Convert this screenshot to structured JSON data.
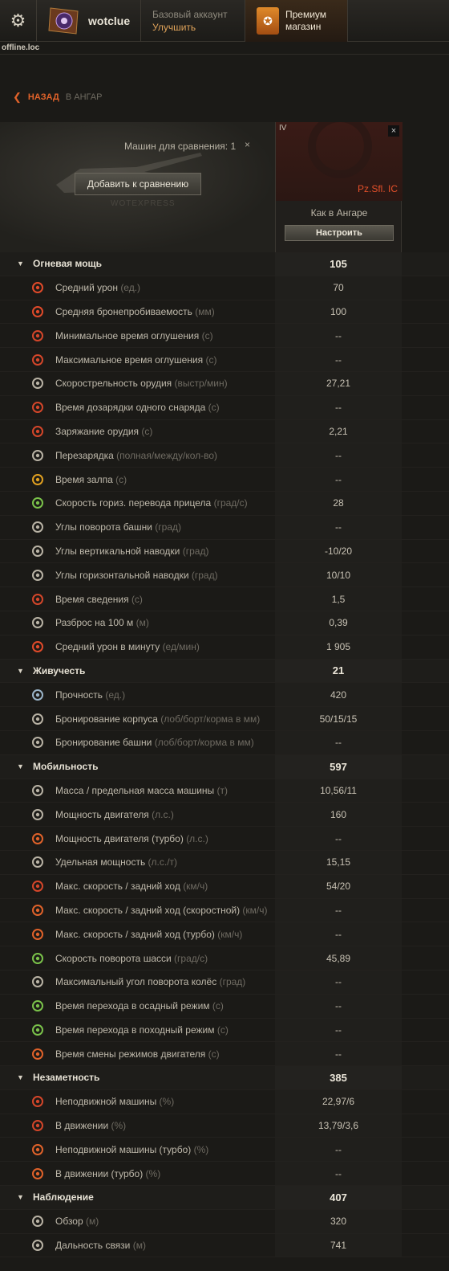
{
  "header": {
    "username": "wotclue",
    "account_type": "Базовый аккаунт",
    "upgrade": "Улучшить",
    "premium_line1": "Премиум",
    "premium_line2": "магазин",
    "server": "offline.loc"
  },
  "nav": {
    "back": "НАЗАД",
    "to_hangar": "В АНГАР"
  },
  "compare": {
    "count_label": "Машин для сравнения: 1",
    "close": "×",
    "add_button": "Добавить к сравнению",
    "watermark": "WOTEXPRESS"
  },
  "vehicle": {
    "tier": "IV",
    "name": "Pz.Sfl. IC",
    "config": "Как в Ангаре",
    "configure_button": "Настроить",
    "close": "×"
  },
  "sections": [
    {
      "title": "Огневая мощь",
      "value": "105",
      "items": [
        {
          "icon": "avg-damage-icon",
          "label": "Средний урон",
          "unit": "(ед.)",
          "value": "70",
          "color": "#e04a2a"
        },
        {
          "icon": "penetration-icon",
          "label": "Средняя бронепробиваемость",
          "unit": "(мм)",
          "value": "100",
          "color": "#e04a2a"
        },
        {
          "icon": "stun-min-icon",
          "label": "Минимальное время оглушения",
          "unit": "(с)",
          "value": "--",
          "color": "#d4462a"
        },
        {
          "icon": "stun-max-icon",
          "label": "Максимальное время оглушения",
          "unit": "(с)",
          "value": "--",
          "color": "#d4462a"
        },
        {
          "icon": "rate-of-fire-icon",
          "label": "Скорострельность орудия",
          "unit": "(выстр/мин)",
          "value": "27,21",
          "color": "#b9b3a5"
        },
        {
          "icon": "shell-reload-icon",
          "label": "Время дозарядки одного снаряда",
          "unit": "(с)",
          "value": "--",
          "color": "#d4462a"
        },
        {
          "icon": "reload-icon",
          "label": "Заряжание орудия",
          "unit": "(с)",
          "value": "2,21",
          "color": "#d4462a"
        },
        {
          "icon": "clip-reload-icon",
          "label": "Перезарядка",
          "unit": "(полная/между/кол-во)",
          "value": "--",
          "color": "#b9b3a5"
        },
        {
          "icon": "salvo-icon",
          "label": "Время залпа",
          "unit": "(с)",
          "value": "--",
          "color": "#e0a020"
        },
        {
          "icon": "traverse-icon",
          "label": "Скорость гориз. перевода прицела",
          "unit": "(град/с)",
          "value": "28",
          "color": "#7ac24a"
        },
        {
          "icon": "turret-angles-icon",
          "label": "Углы поворота башни",
          "unit": "(град)",
          "value": "--",
          "color": "#b9b3a5"
        },
        {
          "icon": "elevation-icon",
          "label": "Углы вертикальной наводки",
          "unit": "(град)",
          "value": "-10/20",
          "color": "#b9b3a5"
        },
        {
          "icon": "horizontal-angles-icon",
          "label": "Углы горизонтальной наводки",
          "unit": "(град)",
          "value": "10/10",
          "color": "#b9b3a5"
        },
        {
          "icon": "aim-time-icon",
          "label": "Время сведения",
          "unit": "(с)",
          "value": "1,5",
          "color": "#d4462a"
        },
        {
          "icon": "dispersion-icon",
          "label": "Разброс на 100 м",
          "unit": "(м)",
          "value": "0,39",
          "color": "#b9b3a5"
        },
        {
          "icon": "dpm-icon",
          "label": "Средний урон в минуту",
          "unit": "(ед/мин)",
          "value": "1 905",
          "color": "#e04a2a"
        }
      ]
    },
    {
      "title": "Живучесть",
      "value": "21",
      "items": [
        {
          "icon": "hp-icon",
          "label": "Прочность",
          "unit": "(ед.)",
          "value": "420",
          "color": "#9ab4c8"
        },
        {
          "icon": "hull-armor-icon",
          "label": "Бронирование корпуса",
          "unit": "(лоб/борт/корма в мм)",
          "value": "50/15/15",
          "color": "#b9b3a5"
        },
        {
          "icon": "turret-armor-icon",
          "label": "Бронирование башни",
          "unit": "(лоб/борт/корма в мм)",
          "value": "--",
          "color": "#b9b3a5"
        }
      ]
    },
    {
      "title": "Мобильность",
      "value": "597",
      "items": [
        {
          "icon": "weight-icon",
          "label": "Масса / предельная масса машины",
          "unit": "(т)",
          "value": "10,56/11",
          "color": "#b9b3a5"
        },
        {
          "icon": "engine-power-icon",
          "label": "Мощность двигателя",
          "unit": "(л.с.)",
          "value": "160",
          "color": "#b9b3a5"
        },
        {
          "icon": "engine-turbo-icon",
          "label": "Мощность двигателя (турбо)",
          "unit": "(л.с.)",
          "value": "--",
          "color": "#e0622a"
        },
        {
          "icon": "specific-power-icon",
          "label": "Удельная мощность",
          "unit": "(л.с./т)",
          "value": "15,15",
          "color": "#b9b3a5"
        },
        {
          "icon": "speed-limit-icon",
          "label": "Макс. скорость / задний ход",
          "unit": "(км/ч)",
          "value": "54/20",
          "color": "#d4462a"
        },
        {
          "icon": "speed-fast-icon",
          "label": "Макс. скорость / задний ход (скоростной)",
          "unit": "(км/ч)",
          "value": "--",
          "color": "#e0622a"
        },
        {
          "icon": "speed-turbo-icon",
          "label": "Макс. скорость / задний ход (турбо)",
          "unit": "(км/ч)",
          "value": "--",
          "color": "#e0622a"
        },
        {
          "icon": "chassis-rotation-icon",
          "label": "Скорость поворота шасси",
          "unit": "(град/с)",
          "value": "45,89",
          "color": "#7ac24a"
        },
        {
          "icon": "wheel-angle-icon",
          "label": "Максимальный угол поворота колёс",
          "unit": "(град)",
          "value": "--",
          "color": "#b9b3a5"
        },
        {
          "icon": "siege-mode-icon",
          "label": "Время перехода в осадный режим",
          "unit": "(с)",
          "value": "--",
          "color": "#7ac24a"
        },
        {
          "icon": "travel-mode-icon",
          "label": "Время перехода в походный режим",
          "unit": "(с)",
          "value": "--",
          "color": "#7ac24a"
        },
        {
          "icon": "engine-mode-icon",
          "label": "Время смены режимов двигателя",
          "unit": "(с)",
          "value": "--",
          "color": "#e0622a"
        }
      ]
    },
    {
      "title": "Незаметность",
      "value": "385",
      "items": [
        {
          "icon": "camo-still-icon",
          "label": "Неподвижной машины",
          "unit": "(%)",
          "value": "22,97/6",
          "color": "#d4462a"
        },
        {
          "icon": "camo-moving-icon",
          "label": "В движении",
          "unit": "(%)",
          "value": "13,79/3,6",
          "color": "#d4462a"
        },
        {
          "icon": "camo-still-turbo-icon",
          "label": "Неподвижной машины (турбо)",
          "unit": "(%)",
          "value": "--",
          "color": "#e0622a"
        },
        {
          "icon": "camo-moving-turbo-icon",
          "label": "В движении (турбо)",
          "unit": "(%)",
          "value": "--",
          "color": "#e0622a"
        }
      ]
    },
    {
      "title": "Наблюдение",
      "value": "407",
      "items": [
        {
          "icon": "view-range-icon",
          "label": "Обзор",
          "unit": "(м)",
          "value": "320",
          "color": "#b9b3a5"
        },
        {
          "icon": "radio-range-icon",
          "label": "Дальность связи",
          "unit": "(м)",
          "value": "741",
          "color": "#b9b3a5"
        }
      ]
    }
  ]
}
